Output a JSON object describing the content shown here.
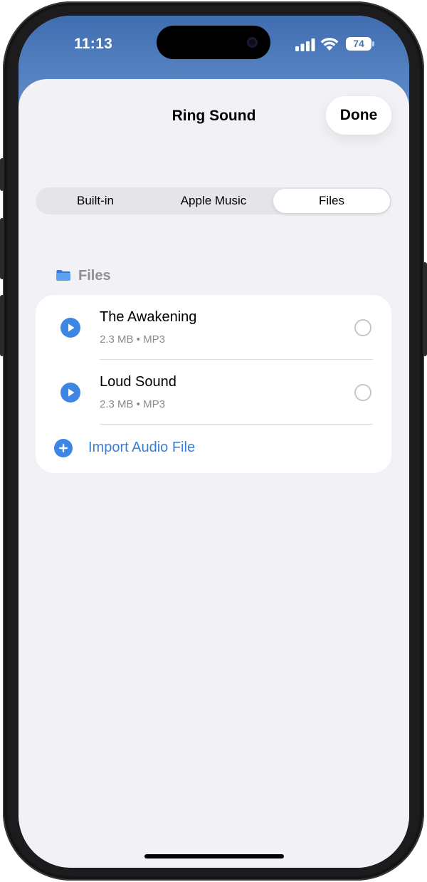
{
  "status_bar": {
    "time": "11:13",
    "battery_level": "74",
    "signal_icon": "cellular-signal-icon",
    "wifi_icon": "wifi-icon"
  },
  "sheet": {
    "title": "Ring Sound",
    "done_label": "Done"
  },
  "segmented_control": {
    "selected": "Files",
    "items": [
      {
        "label": "Built-in"
      },
      {
        "label": "Apple Music"
      },
      {
        "label": "Files"
      }
    ]
  },
  "files_section": {
    "header": "Files",
    "header_icon": "folder-icon",
    "tracks": [
      {
        "title": "The Awakening",
        "meta": "2.3 MB • MP3",
        "selected": false
      },
      {
        "title": "Loud Sound",
        "meta": "2.3 MB • MP3",
        "selected": false
      }
    ],
    "import_label": "Import Audio File"
  },
  "colors": {
    "accent": "#3a7fd3",
    "play_blue": "#3d86e4",
    "background": "#f1f1f6",
    "card": "#ffffff",
    "wallpaper": "#4a75b4"
  }
}
